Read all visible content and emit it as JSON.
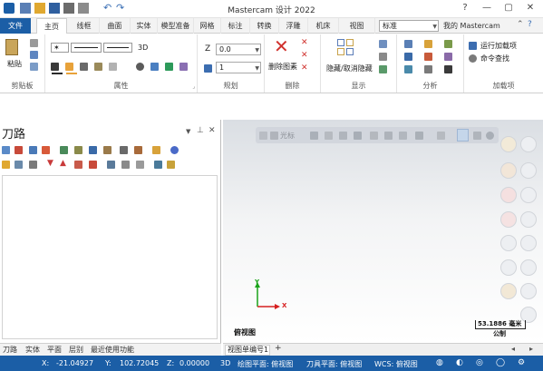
{
  "title_bar": {
    "title": "Mastercam 设计 2022",
    "window_controls": [
      "help-icon",
      "minimize-icon",
      "maximize-icon",
      "close-icon"
    ]
  },
  "ribbon_tabs": [
    "文件",
    "主页",
    "线框",
    "曲面",
    "实体",
    "模型准备",
    "网格",
    "标注",
    "转换",
    "浮雕",
    "机床",
    "视图"
  ],
  "ribbon_right": {
    "config_value": "标准",
    "my_mastercam": "我的 Mastercam"
  },
  "ribbon": {
    "clipboard": {
      "paste_label": "粘贴",
      "group_label": "剪贴板"
    },
    "attributes": {
      "line_width_label": "3D",
      "group_label": "属性"
    },
    "plan": {
      "z_label": "Z",
      "z_value": "0.0",
      "level_value": "1",
      "group_label": "规划"
    },
    "delete": {
      "delete_entity_label": "删除图素",
      "group_label": "删除"
    },
    "display": {
      "hide_label": "隐藏/取消隐藏",
      "group_label": "显示"
    },
    "analysis": {
      "group_label": "分析"
    },
    "addins": {
      "run_addin_label": "运行加载项",
      "command_finder_label": "命令查找",
      "group_label": "加载项"
    }
  },
  "toolpath_panel": {
    "title": "刀路",
    "pin_icon": "pin-icon",
    "close_icon": "close-icon"
  },
  "bottom_tabs": [
    "刀路",
    "实体",
    "平面",
    "层别",
    "最近使用功能"
  ],
  "viewport": {
    "toolbar_label": "光标",
    "view_label": "俯视图",
    "axis_y": "Y",
    "axis_x": "X",
    "scale_value": "53.1886 毫米",
    "unit_label": "公制"
  },
  "viewport_tabs": [
    "视图单编号1",
    "+"
  ],
  "status": {
    "x_label": "X:",
    "x_value": "-21.04927",
    "y_label": "Y:",
    "y_value": "102.72045",
    "z_label": "Z:",
    "z_value": "0.00000",
    "mode": "3D",
    "drawing_plane": "绘图平面: 俯视图",
    "tool_plane": "刀具平面: 俯视图",
    "wcs": "WCS: 俯视图"
  },
  "colors": {
    "accent": "#1b5ea6",
    "delete_red": "#d0312d",
    "axis_green": "#1aa31a",
    "axis_red": "#d62020",
    "viewport_top": "#dadee3"
  }
}
